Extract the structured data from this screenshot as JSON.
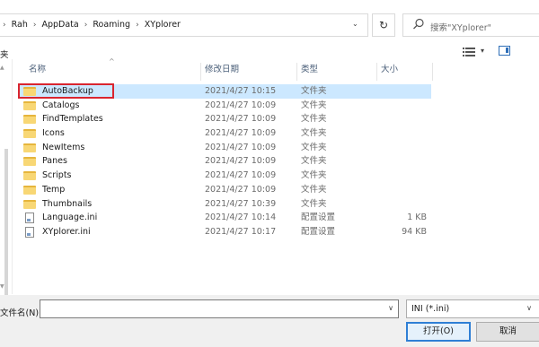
{
  "address": {
    "crumbs": [
      "Rah",
      "AppData",
      "Roaming",
      "XYplorer"
    ],
    "separator": "›",
    "dropdown": "⌄",
    "refresh": "↻"
  },
  "search": {
    "placeholder": "搜索\"XYplorer\""
  },
  "toolbar": {
    "left_fragment": "夹",
    "view_dropdown": "▾"
  },
  "columns": {
    "name": "名称",
    "date": "修改日期",
    "type": "类型",
    "size": "大小",
    "sort_caret": "^"
  },
  "files": [
    {
      "name": "AutoBackup",
      "date": "2021/4/27 10:15",
      "type": "文件夹",
      "size": "",
      "kind": "folder",
      "selected": true
    },
    {
      "name": "Catalogs",
      "date": "2021/4/27 10:09",
      "type": "文件夹",
      "size": "",
      "kind": "folder"
    },
    {
      "name": "FindTemplates",
      "date": "2021/4/27 10:09",
      "type": "文件夹",
      "size": "",
      "kind": "folder"
    },
    {
      "name": "Icons",
      "date": "2021/4/27 10:09",
      "type": "文件夹",
      "size": "",
      "kind": "folder"
    },
    {
      "name": "NewItems",
      "date": "2021/4/27 10:09",
      "type": "文件夹",
      "size": "",
      "kind": "folder"
    },
    {
      "name": "Panes",
      "date": "2021/4/27 10:09",
      "type": "文件夹",
      "size": "",
      "kind": "folder"
    },
    {
      "name": "Scripts",
      "date": "2021/4/27 10:09",
      "type": "文件夹",
      "size": "",
      "kind": "folder"
    },
    {
      "name": "Temp",
      "date": "2021/4/27 10:09",
      "type": "文件夹",
      "size": "",
      "kind": "folder"
    },
    {
      "name": "Thumbnails",
      "date": "2021/4/27 10:39",
      "type": "文件夹",
      "size": "",
      "kind": "folder"
    },
    {
      "name": "Language.ini",
      "date": "2021/4/27 10:14",
      "type": "配置设置",
      "size": "1 KB",
      "kind": "file"
    },
    {
      "name": "XYplorer.ini",
      "date": "2021/4/27 10:17",
      "type": "配置设置",
      "size": "94 KB",
      "kind": "file"
    }
  ],
  "bottom": {
    "filename_label": "文件名(N):",
    "filename_value": "",
    "filetype_value": "INI (*.ini)",
    "open_label": "打开(O)",
    "cancel_label": "取消"
  },
  "colors": {
    "selected_row": "#cce8ff",
    "highlight_box": "#d9252f",
    "folder": "#f8d775"
  }
}
